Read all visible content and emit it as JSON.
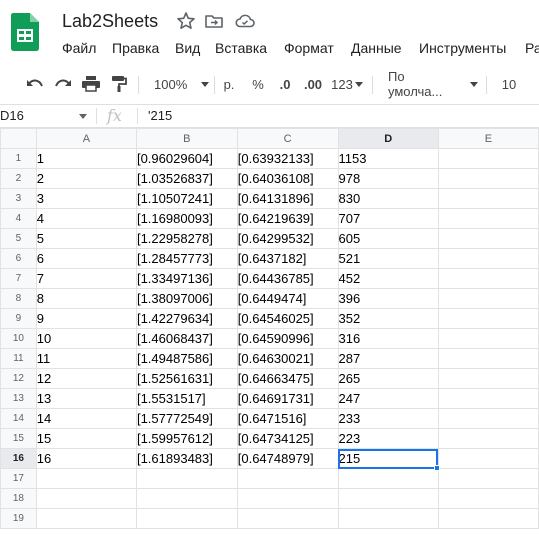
{
  "app": {
    "doc_title": "Lab2Sheets",
    "menu": [
      "Файл",
      "Правка",
      "Вид",
      "Вставка",
      "Формат",
      "Данные",
      "Инструменты",
      "Ра"
    ]
  },
  "toolbar": {
    "zoom": "100%",
    "currency": "р.",
    "percent": "%",
    "decrease_decimals": ".0",
    "increase_decimals": ".00",
    "more_formats": "123",
    "font": "По умолча...",
    "font_size": "10"
  },
  "formula_bar": {
    "cell_ref": "D16",
    "fx": "fx",
    "content": "'215"
  },
  "sheet": {
    "columns": [
      "A",
      "B",
      "C",
      "D",
      "E"
    ],
    "selected_column": "D",
    "selected_row": 16,
    "row_numbers": [
      "1",
      "2",
      "3",
      "4",
      "5",
      "6",
      "7",
      "8",
      "9",
      "10",
      "11",
      "12",
      "13",
      "14",
      "15",
      "16",
      "17",
      "18",
      "19"
    ],
    "rows": [
      [
        "1",
        "[0.96029604]",
        "[0.63932133]",
        "1153",
        ""
      ],
      [
        "2",
        "[1.03526837]",
        "[0.64036108]",
        "978",
        ""
      ],
      [
        "3",
        "[1.10507241]",
        "[0.64131896]",
        "830",
        ""
      ],
      [
        "4",
        "[1.16980093]",
        "[0.64219639]",
        "707",
        ""
      ],
      [
        "5",
        "[1.22958278]",
        "[0.64299532]",
        "605",
        ""
      ],
      [
        "6",
        "[1.28457773]",
        "[0.6437182]",
        "521",
        ""
      ],
      [
        "7",
        "[1.33497136]",
        "[0.64436785]",
        "452",
        ""
      ],
      [
        "8",
        "[1.38097006]",
        "[0.6449474]",
        "396",
        ""
      ],
      [
        "9",
        "[1.42279634]",
        "[0.64546025]",
        "352",
        ""
      ],
      [
        "10",
        "[1.46068437]",
        "[0.64590996]",
        "316",
        ""
      ],
      [
        "11",
        "[1.49487586]",
        "[0.64630021]",
        "287",
        ""
      ],
      [
        "12",
        "[1.52561631]",
        "[0.64663475]",
        "265",
        ""
      ],
      [
        "13",
        "[1.5531517]",
        "[0.64691731]",
        "247",
        ""
      ],
      [
        "14",
        "[1.57772549]",
        "[0.6471516]",
        "233",
        ""
      ],
      [
        "15",
        "[1.59957612]",
        "[0.64734125]",
        "223",
        ""
      ],
      [
        "16",
        "[1.61893483]",
        "[0.64748979]",
        "215",
        ""
      ],
      [
        "",
        "",
        "",
        "",
        ""
      ],
      [
        "",
        "",
        "",
        "",
        ""
      ],
      [
        "",
        "",
        "",
        "",
        ""
      ]
    ]
  },
  "colors": {
    "accent": "#1a73e8",
    "logo_green": "#0f9d58",
    "header_bg": "#f8f9fa"
  }
}
